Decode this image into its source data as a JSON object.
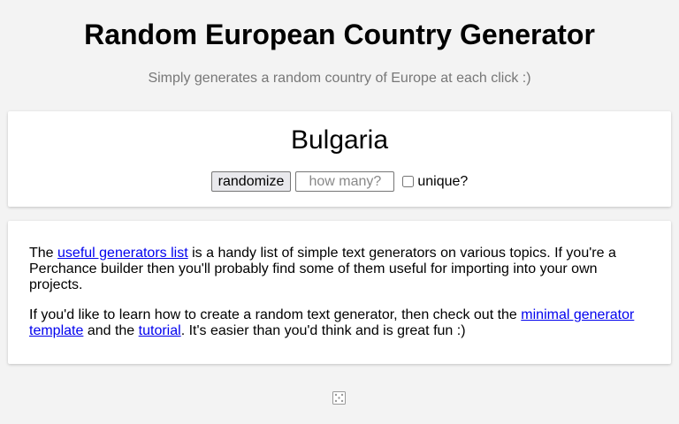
{
  "header": {
    "title": "Random European Country Generator",
    "subtitle": "Simply generates a random country of Europe at each click :)"
  },
  "generator": {
    "result": "Bulgaria",
    "randomize_label": "randomize",
    "count_placeholder": "how many?",
    "count_value": "",
    "unique_label": "unique?",
    "unique_checked": false
  },
  "info": {
    "p1_prefix": "The ",
    "p1_link": "useful generators list",
    "p1_suffix": " is a handy list of simple text generators on various topics. If you're a Perchance builder then you'll probably find some of them useful for importing into your own projects.",
    "p2_prefix": "If you'd like to learn how to create a random text generator, then check out the ",
    "p2_link1": "minimal generator template",
    "p2_middle": " and the ",
    "p2_link2": "tutorial",
    "p2_suffix": ". It's easier than you'd think and is great fun :)"
  },
  "footer": {
    "icon": "dice-icon"
  },
  "colors": {
    "background": "#f3f3f3",
    "card": "#ffffff",
    "link": "#0000ee",
    "subtitle": "#777777"
  }
}
